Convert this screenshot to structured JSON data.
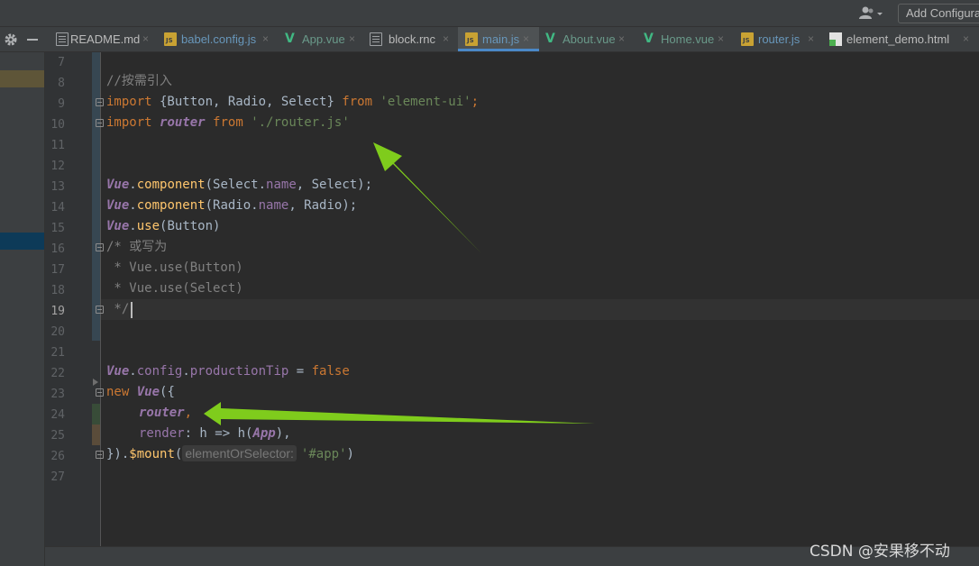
{
  "toolbar": {
    "user_icon": "user-dropdown-icon",
    "add_configuration_label": "Add Configura"
  },
  "tabs": [
    {
      "label": "README.md",
      "icon": "markdown-file-icon",
      "close": "×"
    },
    {
      "label": "babel.config.js",
      "icon": "js-file-icon",
      "close": "×"
    },
    {
      "label": "App.vue",
      "icon": "vue-file-icon",
      "close": "×"
    },
    {
      "label": "block.rnc",
      "icon": "text-file-icon",
      "close": "×"
    },
    {
      "label": "main.js",
      "icon": "js-file-icon",
      "close": "×",
      "active": true
    },
    {
      "label": "About.vue",
      "icon": "vue-file-icon",
      "close": "×"
    },
    {
      "label": "Home.vue",
      "icon": "vue-file-icon",
      "close": "×"
    },
    {
      "label": "router.js",
      "icon": "js-file-icon",
      "close": "×"
    },
    {
      "label": "element_demo.html",
      "icon": "html-file-icon",
      "close": "×"
    }
  ],
  "vue_glyph": "V",
  "line_numbers": [
    "7",
    "8",
    "9",
    "10",
    "11",
    "12",
    "13",
    "14",
    "15",
    "16",
    "17",
    "18",
    "19",
    "20",
    "21",
    "22",
    "23",
    "24",
    "25",
    "26",
    "27"
  ],
  "current_line": "19",
  "code": {
    "l8_comment": "//按需引入",
    "l9_import": "import",
    "l9_braces": " {Button, Radio, Select} ",
    "l9_from": "from",
    "l9_str": "'element-ui'",
    "l9_semi": ";",
    "l10_import": "import",
    "l10_router": "router",
    "l10_from": "from",
    "l10_str": "'./router.js'",
    "l13_vue": "Vue",
    "l13_dot": ".",
    "l13_fn": "component",
    "l13_a": "(Select.",
    "l13_name": "name",
    "l13_b": ", Select);",
    "l14_vue": "Vue",
    "l14_dot": ".",
    "l14_fn": "component",
    "l14_a": "(Radio.",
    "l14_name": "name",
    "l14_b": ", Radio);",
    "l15_vue": "Vue",
    "l15_dot": ".",
    "l15_fn": "use",
    "l15_a": "(Button)",
    "l16": "/* 或写为",
    "l17": " * Vue.use(Button)",
    "l18": " * Vue.use(Select)",
    "l19": " */",
    "l22_vue": "Vue",
    "l22_dot1": ".",
    "l22_config": "config",
    "l22_dot2": ".",
    "l22_prop": "productionTip",
    "l22_eq": " = ",
    "l22_false": "false",
    "l23_new": "new",
    "l23_vue": "Vue",
    "l23_paren": "({",
    "l24_router": "router",
    "l24_comma": ",",
    "l25_render": "render",
    "l25_mid": ": h => h(",
    "l25_app": "App",
    "l25_end": "),",
    "l26_a": "}).",
    "l26_mount": "$mount",
    "l26_paren": "(",
    "l26_hint": "elementOrSelector:",
    "l26_str": "'#app'",
    "l26_end": ")"
  },
  "annotation_colors": {
    "arrow": "#7fcc1c"
  },
  "watermark": "CSDN @安果移不动"
}
